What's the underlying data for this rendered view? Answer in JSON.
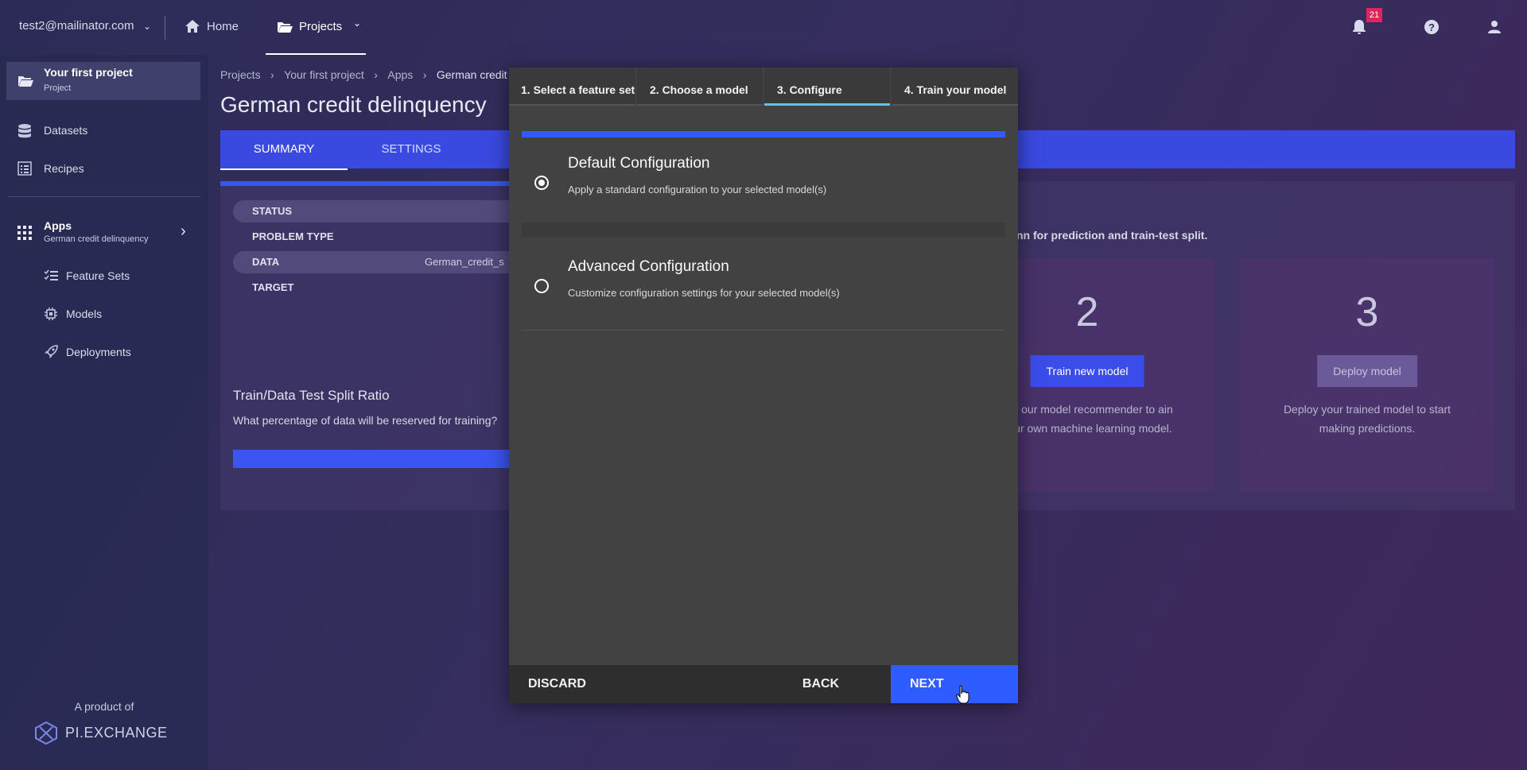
{
  "topbar": {
    "account_email": "test2@mailinator.com",
    "home_label": "Home",
    "projects_label": "Projects",
    "notification_count": "21"
  },
  "sidebar": {
    "project_name": "Your first project",
    "project_type": "Project",
    "datasets_label": "Datasets",
    "recipes_label": "Recipes",
    "apps_label": "Apps",
    "apps_sub": "German credit delinquency",
    "feature_sets_label": "Feature Sets",
    "models_label": "Models",
    "deployments_label": "Deployments",
    "product_of": "A product of",
    "brand": "PI.EXCHANGE"
  },
  "page": {
    "breadcrumbs": [
      "Projects",
      "Your first project",
      "Apps",
      "German credit delinqu"
    ],
    "title": "German credit delinquency",
    "tabs": [
      "SUMMARY",
      "SETTINGS"
    ],
    "summary_rows": [
      {
        "label": "STATUS",
        "value": ""
      },
      {
        "label": "PROBLEM TYPE",
        "value": ""
      },
      {
        "label": "DATA",
        "value": "German_credit_s"
      },
      {
        "label": "TARGET",
        "value": ""
      }
    ],
    "split_title": "Train/Data Test Split Ratio",
    "split_question": "What percentage of data will be reserved for training?",
    "hint_text": "nn for prediction and train-test split.",
    "cards": [
      {
        "number": "2",
        "button": "Train new model",
        "desc": "low our model recommender to ain your own machine learning model."
      },
      {
        "number": "3",
        "button": "Deploy model",
        "desc": "Deploy your trained model to start making predictions."
      }
    ]
  },
  "modal": {
    "steps": [
      "1. Select a feature set",
      "2. Choose a model",
      "3. Configure",
      "4. Train your model"
    ],
    "options": [
      {
        "title": "Default Configuration",
        "subtitle": "Apply a standard configuration to your selected model(s)",
        "selected": true
      },
      {
        "title": "Advanced Configuration",
        "subtitle": "Customize configuration settings for your selected model(s)",
        "selected": false
      }
    ],
    "discard_label": "DISCARD",
    "back_label": "BACK",
    "next_label": "NEXT"
  },
  "colors": {
    "accent": "#2f5cff",
    "step_active": "#5ec3f2",
    "notification_badge": "#e0245e"
  }
}
